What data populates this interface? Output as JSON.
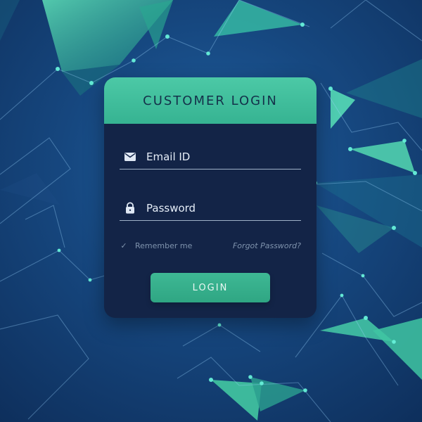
{
  "login_card": {
    "title": "CUSTOMER LOGIN",
    "email_label": "Email ID",
    "password_label": "Password",
    "remember_label": "Remember me",
    "forgot_label": "Forgot Password?",
    "login_label": "LOGIN"
  },
  "icons": {
    "email": "mail-icon",
    "password": "lock-icon",
    "remember": "check-icon"
  },
  "colors": {
    "background_primary": "#16477f",
    "background_dark": "#0e2f5c",
    "accent": "#3eb894",
    "card": "#132447",
    "text_primary": "#e5edf7",
    "text_muted": "#7f93ad"
  }
}
